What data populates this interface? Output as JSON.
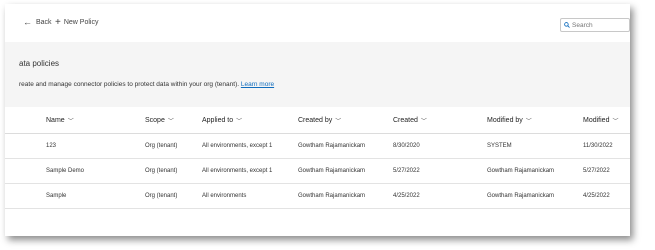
{
  "commandbar": {
    "back_label": "Back",
    "new_policy_label": "New Policy",
    "search_placeholder": "Search"
  },
  "header": {
    "title": "ata policies",
    "description": "reate and manage connector policies to protect data within your org (tenant).",
    "learn_more": "Learn more"
  },
  "table": {
    "columns": [
      "Name",
      "Scope",
      "Applied to",
      "Created by",
      "Created",
      "Modified by",
      "Modified"
    ],
    "rows": [
      [
        "123",
        "Org (tenant)",
        "All environments, except 1",
        "Gowtham Rajamanickam",
        "8/30/2020",
        "SYSTEM",
        "11/30/2022"
      ],
      [
        "Sample Demo",
        "Org (tenant)",
        "All environments, except 1",
        "Gowtham Rajamanickam",
        "5/27/2022",
        "Gowtham Rajamanickam",
        "5/27/2022"
      ],
      [
        "Sample",
        "Org (tenant)",
        "All environments",
        "Gowtham Rajamanickam",
        "4/25/2022",
        "Gowtham Rajamanickam",
        "4/25/2022"
      ]
    ]
  },
  "colors": {
    "accent": "#0f6cbd",
    "band": "#f5f5f5"
  }
}
